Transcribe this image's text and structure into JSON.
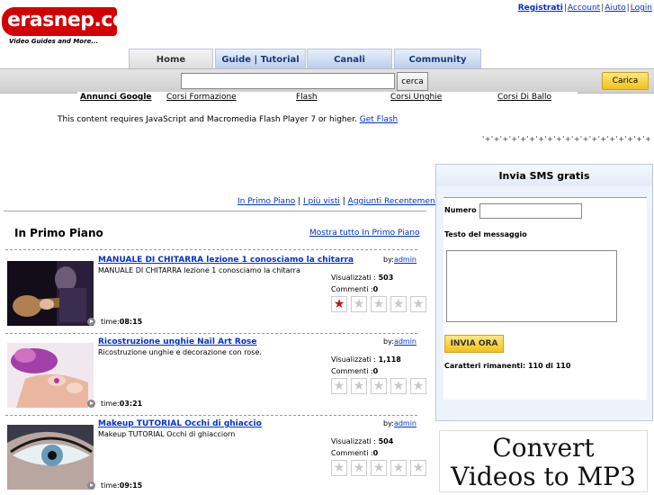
{
  "header": {
    "logo_text": "erasnep.com",
    "logo_tagline": "Video Guides and More...",
    "links": [
      "Registrati",
      "Account",
      "Aiuto",
      "Login"
    ]
  },
  "tabs": [
    "Home",
    "Guide | Tutorial",
    "Canali",
    "Community"
  ],
  "search": {
    "button": "cerca",
    "upload_button": "Carica"
  },
  "ads": {
    "label": "Annunci Google",
    "items": [
      "Corsi Formazione",
      "Flash",
      "Corsi Unghie",
      "Corsi Di Ballo"
    ]
  },
  "flash": {
    "message": "This content requires JavaScript and Macromedia Flash Player 7 or higher.",
    "link": "Get Flash"
  },
  "plus_row": "'+'+'+'+'+'+'+'+'+'+'+'+'+'+'+'+'+'+'+",
  "filters": [
    "In Primo Piano",
    "I più visti",
    "Aggiunti Recentemente"
  ],
  "section": {
    "title": "In Primo Piano",
    "show_all": "Mostra tutto In Primo Piano"
  },
  "videos": [
    {
      "title": "MANUALE DI CHITARRA lezione 1 conosciamo la chitarra",
      "desc": "MANUALE DI CHITARRA lezione 1 conosciamo la chitarra",
      "by_label": "by:",
      "author": "admin",
      "views_label": "Visualizzati :",
      "views": "503",
      "comments_label": "Commenti :",
      "comments": "0",
      "time_label": "time:",
      "time": "08:15",
      "rating": 1
    },
    {
      "title": "Ricostruzione unghie Nail Art Rose",
      "desc": "Ricostruzione unghie e decorazione con rose.",
      "by_label": "by:",
      "author": "admin",
      "views_label": "Visualizzati :",
      "views": "1,118",
      "comments_label": "Commenti :",
      "comments": "0",
      "time_label": "time:",
      "time": "03:21",
      "rating": 0
    },
    {
      "title": "Makeup TUTORIAL Occhi di ghiaccio",
      "desc": "Makeup TUTORIAL Occhi di ghiacciorn",
      "by_label": "by:",
      "author": "admin",
      "views_label": "Visualizzati :",
      "views": "504",
      "comments_label": "Commenti :",
      "comments": "0",
      "time_label": "time:",
      "time": "09:15",
      "rating": 0
    }
  ],
  "sms": {
    "title": "Invia SMS gratis",
    "number_label": "Numero",
    "message_label": "Testo del messaggio",
    "send_button": "INVIA ORA",
    "chars_remaining": "Caratteri rimanenti: 110 di 110"
  },
  "ad_banner": {
    "line1": "Convert",
    "line2": "Videos to MP3"
  },
  "colors": {
    "accent_red": "#d40000",
    "link_blue": "#0033cc",
    "button_yellow": "#f2c21a"
  }
}
